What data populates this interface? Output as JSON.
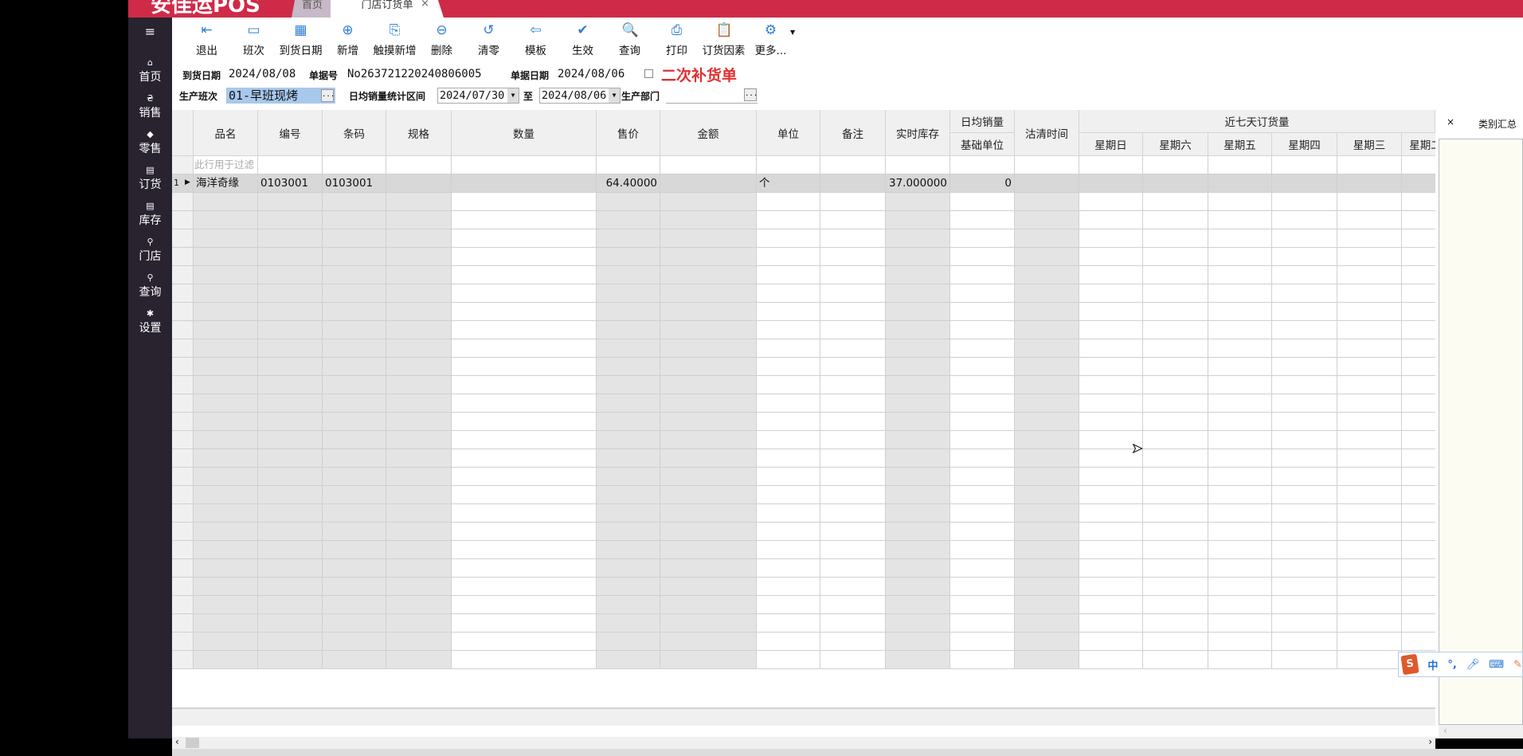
{
  "app": {
    "logo": "安佳运POS",
    "tabs": [
      {
        "label": "首页"
      },
      {
        "label": "门店订货单",
        "close": "×"
      }
    ]
  },
  "sidebar": {
    "menu_icon": "≡",
    "items": [
      {
        "label": "首页",
        "icon": "home-icon",
        "glyph": "⌂"
      },
      {
        "label": "销售",
        "icon": "currency-icon",
        "glyph": "₴"
      },
      {
        "label": "零售",
        "icon": "tag-icon",
        "glyph": "◆"
      },
      {
        "label": "订货",
        "icon": "store-icon",
        "glyph": "▤"
      },
      {
        "label": "库存",
        "icon": "store-icon",
        "glyph": "▤"
      },
      {
        "label": "门店",
        "icon": "search-icon",
        "glyph": "⚲"
      },
      {
        "label": "查询",
        "icon": "search-icon",
        "glyph": "⚲"
      },
      {
        "label": "设置",
        "icon": "gear-icon",
        "glyph": "✱"
      }
    ]
  },
  "toolbar": [
    {
      "label": "退出",
      "icon": "exit-icon",
      "glyph": "⇤"
    },
    {
      "label": "班次",
      "icon": "shift-icon",
      "glyph": "▭"
    },
    {
      "label": "到货日期",
      "icon": "calendar-icon",
      "glyph": "▦"
    },
    {
      "label": "新增",
      "icon": "add-icon",
      "glyph": "⊕"
    },
    {
      "label": "触摸新增",
      "icon": "touch-add-icon",
      "glyph": "⎘"
    },
    {
      "label": "删除",
      "icon": "delete-icon",
      "glyph": "⊖"
    },
    {
      "label": "清零",
      "icon": "reset-icon",
      "glyph": "↺"
    },
    {
      "label": "模板",
      "icon": "template-icon",
      "glyph": "⇦"
    },
    {
      "label": "生效",
      "icon": "check-icon",
      "glyph": "✔"
    },
    {
      "label": "查询",
      "icon": "search-icon",
      "glyph": "🔍"
    },
    {
      "label": "打印",
      "icon": "print-icon",
      "glyph": "⎙"
    },
    {
      "label": "订货因素",
      "icon": "clipboard-icon",
      "glyph": "📋"
    },
    {
      "label": "更多...",
      "icon": "gear-icon",
      "glyph": "⚙"
    }
  ],
  "form": {
    "arrival_date_label": "到货日期",
    "arrival_date": "2024/08/08",
    "doc_no_label": "单据号",
    "doc_no": "No263721220240806005",
    "doc_date_label": "单据日期",
    "doc_date": "2024/08/06",
    "second_replenish_label": "二次补货单",
    "second_replenish_checked": false,
    "shift_label": "生产班次",
    "shift_value": "01-早班现烤",
    "range_label": "日均销量统计区间",
    "range_from": "2024/07/30",
    "range_to_label": "至",
    "range_to": "2024/08/06",
    "dept_label": "生产部门",
    "dept_value": "",
    "dots": "..."
  },
  "grid": {
    "columns": [
      {
        "label": "品名",
        "gray": true
      },
      {
        "label": "编号",
        "gray": true
      },
      {
        "label": "条码",
        "gray": true
      },
      {
        "label": "规格",
        "gray": true
      },
      {
        "label": "数量",
        "gray": false
      },
      {
        "label": "售价",
        "gray": true
      },
      {
        "label": "金额",
        "gray": true
      },
      {
        "label": "单位",
        "gray": false
      },
      {
        "label": "备注",
        "gray": false
      },
      {
        "label": "实时库存",
        "gray": true
      },
      {
        "label": "日均销量",
        "sub": "基础单位",
        "gray": false
      },
      {
        "label": "沽清时间",
        "gray": true
      },
      {
        "label": "星期日",
        "gray": false
      },
      {
        "label": "星期六",
        "gray": false
      },
      {
        "label": "星期五",
        "gray": false
      },
      {
        "label": "星期四",
        "gray": false
      },
      {
        "label": "星期三",
        "gray": false
      },
      {
        "label": "星期二",
        "gray": false
      }
    ],
    "group_header": "近七天订货量",
    "filter_placeholder": "此行用于过滤",
    "rows": [
      {
        "num": "1",
        "cells": [
          "海洋奇缘",
          "0103001",
          "0103001",
          "",
          "",
          "64.40000",
          "",
          "个",
          "",
          "37.000000",
          "0",
          "",
          "",
          "",
          "",
          "",
          "",
          ""
        ]
      }
    ]
  },
  "right_panel": {
    "close": "×",
    "title": "类别汇总"
  },
  "ime": {
    "mode": "中",
    "punct": "°,"
  }
}
